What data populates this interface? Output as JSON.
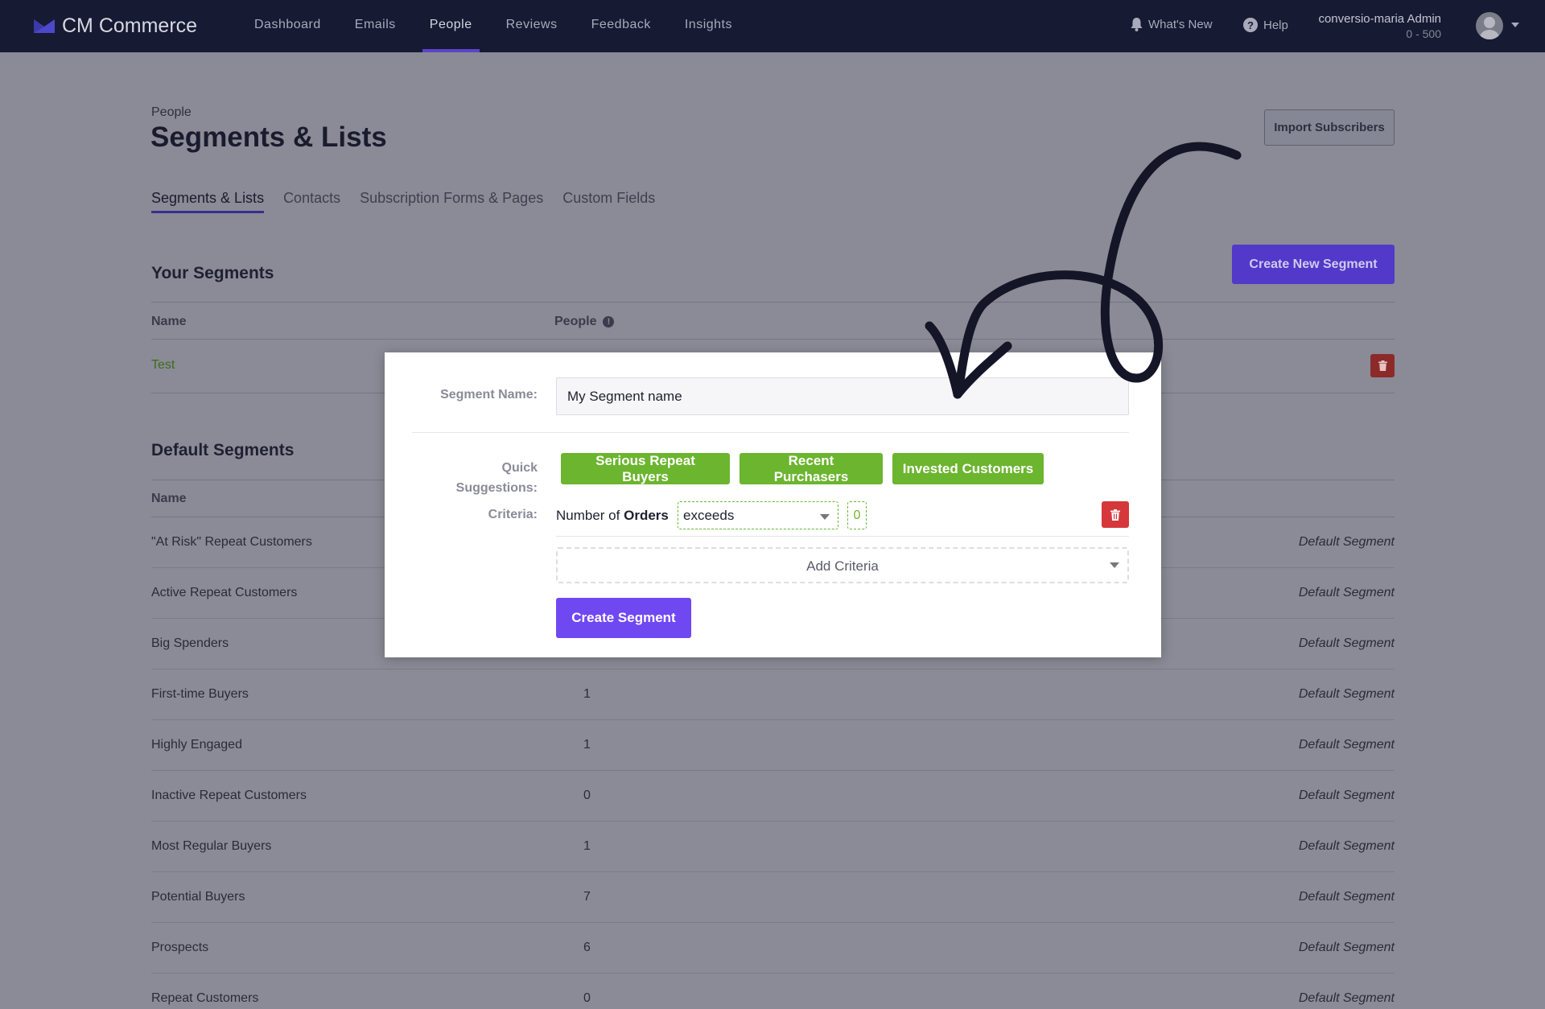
{
  "app": {
    "name": "CM Commerce"
  },
  "nav": {
    "links": [
      "Dashboard",
      "Emails",
      "People",
      "Reviews",
      "Feedback",
      "Insights"
    ],
    "active": "People",
    "whats_new": "What's New",
    "help": "Help",
    "account_name": "conversio-maria Admin",
    "account_range": "0 - 500"
  },
  "page": {
    "breadcrumb": "People",
    "title": "Segments & Lists",
    "import_button": "Import Subscribers",
    "tabs": [
      "Segments & Lists",
      "Contacts",
      "Subscription Forms & Pages",
      "Custom Fields"
    ]
  },
  "your_segments": {
    "title": "Your Segments",
    "create_button": "Create New Segment",
    "col_name": "Name",
    "col_people": "People",
    "rows": [
      {
        "name": "Test"
      }
    ]
  },
  "default_segments": {
    "title": "Default Segments",
    "col_name": "Name",
    "rows": [
      {
        "name": "\"At Risk\" Repeat Customers",
        "count": "",
        "type": "Default Segment"
      },
      {
        "name": "Active Repeat Customers",
        "count": "",
        "type": "Default Segment"
      },
      {
        "name": "Big Spenders",
        "count": "",
        "type": "Default Segment"
      },
      {
        "name": "First-time Buyers",
        "count": "1",
        "type": "Default Segment"
      },
      {
        "name": "Highly Engaged",
        "count": "1",
        "type": "Default Segment"
      },
      {
        "name": "Inactive Repeat Customers",
        "count": "0",
        "type": "Default Segment"
      },
      {
        "name": "Most Regular Buyers",
        "count": "1",
        "type": "Default Segment"
      },
      {
        "name": "Potential Buyers",
        "count": "7",
        "type": "Default Segment"
      },
      {
        "name": "Prospects",
        "count": "6",
        "type": "Default Segment"
      },
      {
        "name": "Repeat Customers",
        "count": "0",
        "type": "Default Segment"
      }
    ]
  },
  "modal": {
    "segment_name_label": "Segment Name:",
    "segment_name_value": "My Segment name",
    "quick_label_1": "Quick",
    "quick_label_2": "Suggestions:",
    "suggestions": [
      "Serious Repeat Buyers",
      "Recent Purchasers",
      "Invested Customers"
    ],
    "criteria_label": "Criteria:",
    "criteria_prefix": "Number of",
    "criteria_field": "Orders",
    "criteria_operator": "exceeds",
    "criteria_value": "0",
    "add_criteria": "Add Criteria",
    "create_button": "Create Segment"
  },
  "colors": {
    "nav_bg": "#161a33",
    "accent_purple": "#7048f2",
    "suggestion_green": "#6cb52f",
    "danger_red": "#d6373a"
  },
  "icons": [
    "logo-icon",
    "bell-icon",
    "help-icon",
    "info-icon",
    "avatar-icon",
    "trash-icon",
    "chevron-down-icon",
    "hand-drawn-arrow"
  ]
}
